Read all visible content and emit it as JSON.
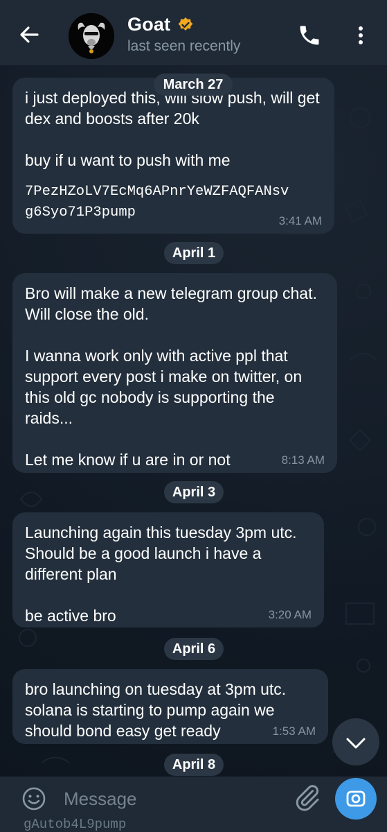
{
  "header": {
    "contact_name": "Goat",
    "status": "last seen recently"
  },
  "messages": [
    {
      "date": "March 27",
      "text": "i just deployed this, will slow push, will get dex and boosts after 20k\n\nbuy if u want to push with me",
      "code": "7PezHZoLV7EcMq6APnrYeWZFAQFANsv\ng6Syo71P3pump",
      "time": "3:41 AM"
    },
    {
      "date": "April 1",
      "text": "Bro will make a new telegram group chat. Will close the old.\n\nI wanna work only with active ppl that support every post i make on twitter, on this old gc nobody is supporting the raids...\n\nLet me know if u are in or not",
      "time": "8:13 AM"
    },
    {
      "date": "April 3",
      "text": "Launching again this tuesday 3pm utc. Should be a good launch i have a different plan\n\nbe active bro",
      "time": "3:20 AM"
    },
    {
      "date": "April 6",
      "text": "bro launching on tuesday at 3pm utc. solana is starting to pump again we should bond easy get ready",
      "time": "1:53 AM"
    }
  ],
  "next_date": "April 8",
  "peek_text": "gAutob4L9pump",
  "composer": {
    "placeholder": "Message"
  },
  "colors": {
    "header_bg": "#1f2a36",
    "bubble_bg": "#232f3c",
    "accent": "#3e9ae6",
    "verified_badge": "#f2a91d"
  }
}
